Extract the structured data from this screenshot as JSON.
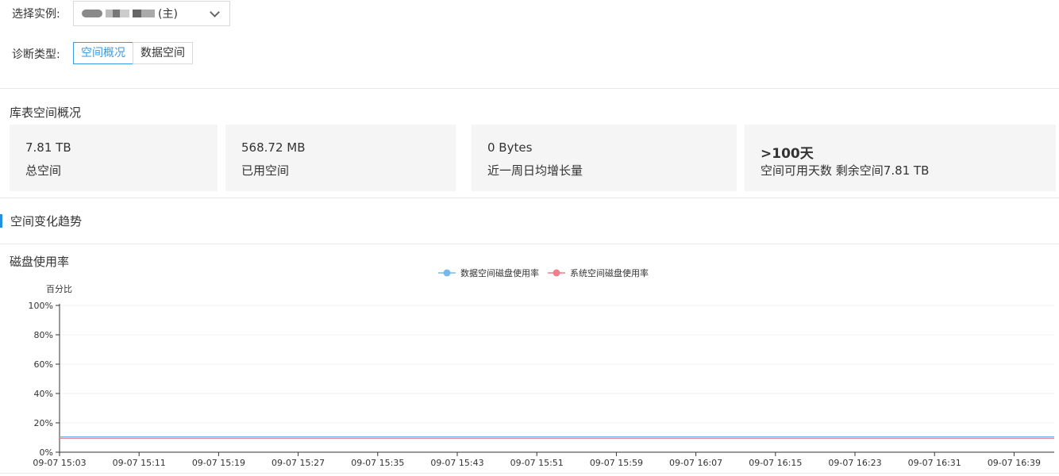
{
  "instance": {
    "label": "选择实例:",
    "selected_suffix": "(主)"
  },
  "diagnosis": {
    "label": "诊断类型:",
    "tabs": [
      {
        "label": "空间概况",
        "active": true
      },
      {
        "label": "数据空间",
        "active": false
      }
    ]
  },
  "overview": {
    "title": "库表空间概况",
    "stats": [
      {
        "value": "7.81 TB",
        "label": "总空间"
      },
      {
        "value": "568.72 MB",
        "label": "已用空间"
      },
      {
        "value": "0 Bytes",
        "label": "近一周日均增长量"
      },
      {
        "value": ">100天",
        "label": "空间可用天数 剩余空间7.81 TB"
      }
    ]
  },
  "trend": {
    "section_title": "空间变化趋势"
  },
  "chart_data": {
    "type": "line",
    "title": "磁盘使用率",
    "ylabel": "百分比",
    "ylim": [
      0,
      100
    ],
    "yticks": [
      "0%",
      "20%",
      "40%",
      "60%",
      "80%",
      "100%"
    ],
    "ytick_values": [
      0,
      20,
      40,
      60,
      80,
      100
    ],
    "categories": [
      "09-07 15:03",
      "09-07 15:11",
      "09-07 15:19",
      "09-07 15:27",
      "09-07 15:35",
      "09-07 15:43",
      "09-07 15:51",
      "09-07 15:59",
      "09-07 16:07",
      "09-07 16:15",
      "09-07 16:23",
      "09-07 16:31",
      "09-07 16:39"
    ],
    "legend_position": "top-center",
    "series": [
      {
        "name": "数据空间磁盘使用率",
        "color": "#74b9ee",
        "values": [
          10.5,
          10.5,
          10.5,
          10.5,
          10.5,
          10.5,
          10.5,
          10.5,
          10.5,
          10.5,
          10.5,
          10.5,
          10.5,
          10.5
        ]
      },
      {
        "name": "系统空间磁盘使用率",
        "color": "#f07f8a",
        "values": [
          9.5,
          9.5,
          9.5,
          9.5,
          9.5,
          9.5,
          9.5,
          9.5,
          9.5,
          9.5,
          9.5,
          9.5,
          9.5,
          9.5
        ]
      }
    ]
  }
}
